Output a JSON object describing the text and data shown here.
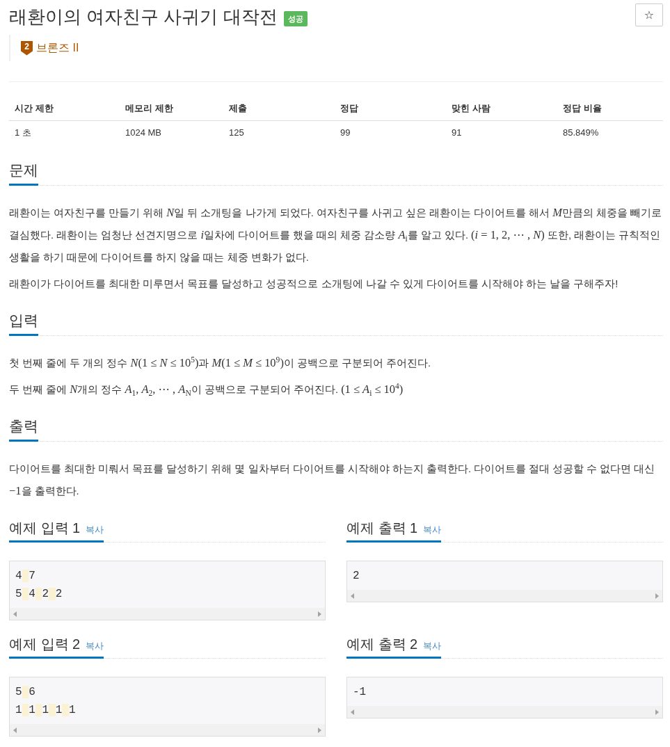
{
  "title": "래환이의 여자친구 사귀기 대작전",
  "result_badge": "성공",
  "star_button": "☆",
  "tier": {
    "badge_number": "2",
    "label": "브론즈 II"
  },
  "stats_table": {
    "columns": [
      "시간 제한",
      "메모리 제한",
      "제출",
      "정답",
      "맞힌 사람",
      "정답 비율"
    ],
    "rows": [
      [
        "1 초",
        "1024 MB",
        "125",
        "99",
        "91",
        "85.849%"
      ]
    ]
  },
  "sections": [
    {
      "title": "문제",
      "paragraphs": [
        {
          "segments": [
            {
              "kind": "text",
              "text": "래환이는 여자친구를 만들기 위해 "
            },
            {
              "kind": "math",
              "text": "*N*"
            },
            {
              "kind": "text",
              "text": "일 뒤 소개팅을 나가게 되었다. 여자친구를 사귀고 싶은 래환이는 다이어트를 해서 "
            },
            {
              "kind": "math",
              "text": "*M*"
            },
            {
              "kind": "text",
              "text": "만큼의 체중을 빼기로 결심했다. 래환이는 엄청난 선견지명으로 "
            },
            {
              "kind": "math",
              "text": "*i*"
            },
            {
              "kind": "text",
              "text": "일차에 다이어트를 했을 때의 체중 감소량 "
            },
            {
              "kind": "math",
              "text": "*A*$_{i}$"
            },
            {
              "kind": "text",
              "text": "를 알고 있다. "
            },
            {
              "kind": "math",
              "text": "(*i* = 1, 2, ⋯ , *N*)"
            },
            {
              "kind": "text",
              "text": " 또한, 래환이는 규칙적인 생활을 하기 때문에 다이어트를 하지 않을 때는 체중 변화가 없다."
            }
          ]
        },
        {
          "segments": [
            {
              "kind": "text",
              "text": "래환이가 다이어트를 최대한 미루면서 목표를 달성하고 성공적으로 소개팅에 나갈 수 있게 다이어트를 시작해야 하는 날을 구해주자!"
            }
          ]
        }
      ]
    },
    {
      "title": "입력",
      "paragraphs": [
        {
          "segments": [
            {
              "kind": "text",
              "text": "첫 번째 줄에 두 개의 정수 "
            },
            {
              "kind": "math",
              "text": "*N*(1 ≤ *N* ≤ 10$^{5}$)"
            },
            {
              "kind": "text",
              "text": "과 "
            },
            {
              "kind": "math",
              "text": "*M*(1 ≤ *M* ≤ 10$^{9}$)"
            },
            {
              "kind": "text",
              "text": "이 공백으로 구분되어 주어진다."
            }
          ]
        },
        {
          "segments": [
            {
              "kind": "text",
              "text": "두 번째 줄에 "
            },
            {
              "kind": "math",
              "text": "*N*"
            },
            {
              "kind": "text",
              "text": "개의 정수 "
            },
            {
              "kind": "math",
              "text": "*A*$_{1}$, *A*$_{2}$, ⋯ , *A*$_{N}$"
            },
            {
              "kind": "text",
              "text": "이 공백으로 구분되어 주어진다. "
            },
            {
              "kind": "math",
              "text": "(1 ≤ *A*$_{i}$ ≤ 10$^{4}$)"
            }
          ]
        }
      ]
    },
    {
      "title": "출력",
      "paragraphs": [
        {
          "segments": [
            {
              "kind": "text",
              "text": "다이어트를 최대한 미뤄서 목표를 달성하기 위해 몇 일차부터 다이어트를 시작해야 하는지 출력한다. 다이어트를 절대 성공할 수 없다면 대신 "
            },
            {
              "kind": "math",
              "text": "−1"
            },
            {
              "kind": "text",
              "text": "을 출력한다."
            }
          ]
        }
      ]
    }
  ],
  "examples": [
    {
      "title": "예제 입력 1",
      "copy_link": "복사",
      "lines": [
        "4 7",
        "5 4 2 2"
      ]
    },
    {
      "title": "예제 출력 1",
      "copy_link": "복사",
      "lines": [
        "2"
      ]
    },
    {
      "title": "예제 입력 2",
      "copy_link": "복사",
      "lines": [
        "5 6",
        "1 1 1 1 1"
      ]
    },
    {
      "title": "예제 출력 2",
      "copy_link": "복사",
      "lines": [
        "-1"
      ]
    }
  ]
}
